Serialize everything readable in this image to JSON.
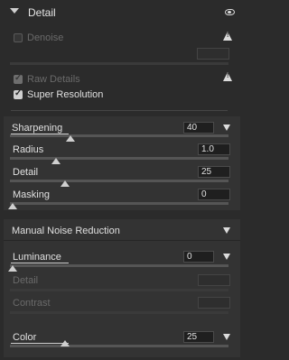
{
  "detail_panel": {
    "title": "Detail",
    "denoise": {
      "label": "Denoise",
      "checked": false
    },
    "raw_details": {
      "label": "Raw Details",
      "checked": true
    },
    "super_resolution": {
      "label": "Super Resolution",
      "checked": true
    }
  },
  "sharpening": {
    "sharpening": {
      "label": "Sharpening",
      "value": "40",
      "level": 0.27
    },
    "radius": {
      "label": "Radius",
      "value": "1.0",
      "level": 0.21
    },
    "detail": {
      "label": "Detail",
      "value": "25",
      "level": 0.25
    },
    "masking": {
      "label": "Masking",
      "value": "0",
      "level": 0.0
    }
  },
  "noise_reduction": {
    "title": "Manual Noise Reduction",
    "luminance": {
      "label": "Luminance",
      "value": "0",
      "level": 0.0
    },
    "detail": {
      "label": "Detail"
    },
    "contrast": {
      "label": "Contrast"
    },
    "color": {
      "label": "Color",
      "value": "25",
      "level": 0.25
    }
  },
  "icons": [
    "chevron-down-icon",
    "eye-icon",
    "warning-icon",
    "checkmark-icon",
    "dropdown-triangle-icon",
    "slider-thumb-icon"
  ]
}
